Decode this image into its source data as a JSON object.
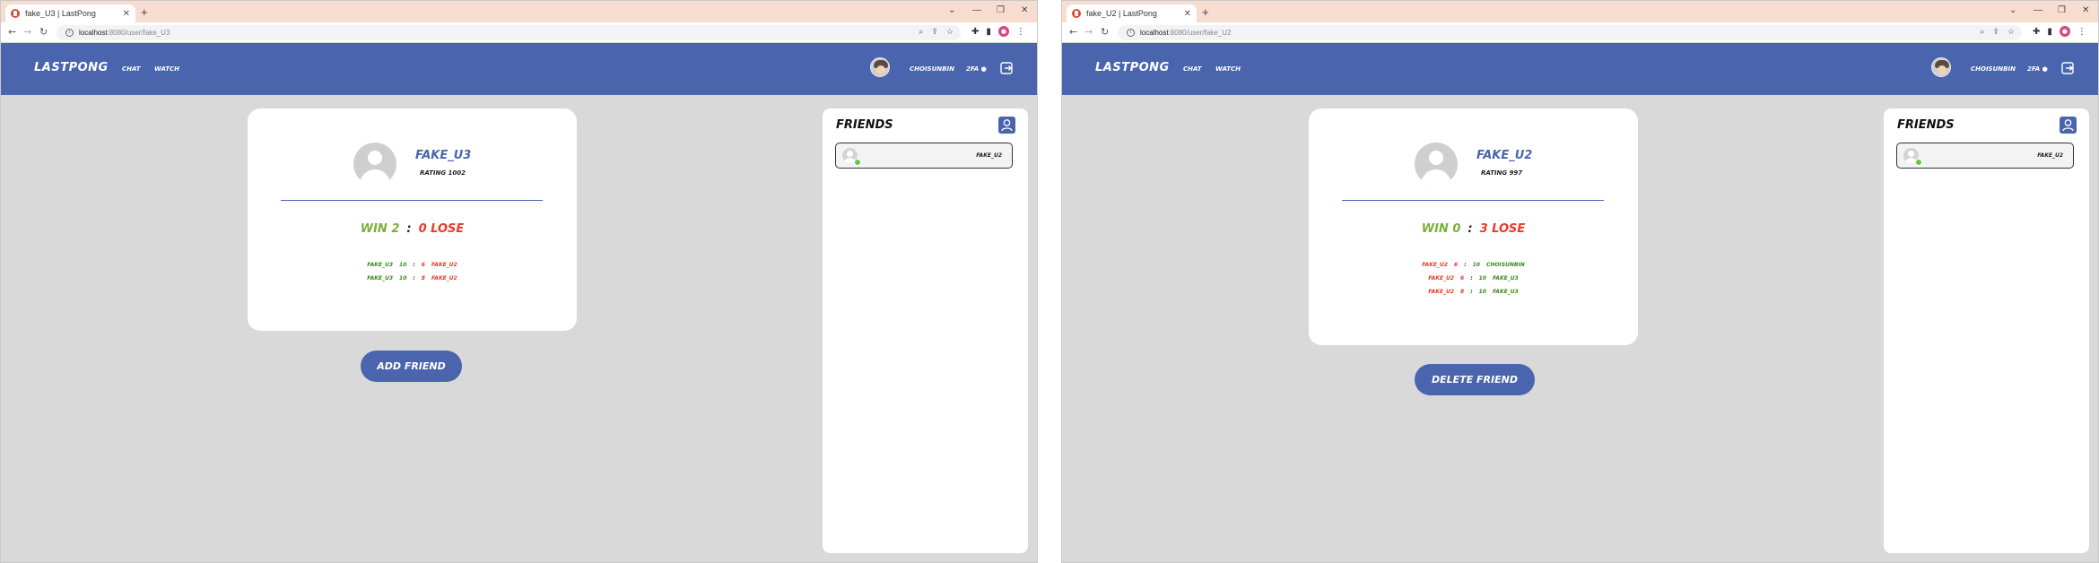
{
  "windows": [
    {
      "tab_title": "fake_U3 | LastPong",
      "url_host": "localhost",
      "url_path": ":8080/user/fake_U3",
      "app": {
        "logo": "LASTPONG",
        "nav_chat": "CHAT",
        "nav_watch": "WATCH",
        "username": "CHOISUNBIN",
        "twofa": "2FA"
      },
      "profile": {
        "name": "FAKE_U3",
        "rating": "RATING 1002",
        "win_label": "WIN 2",
        "colon": ":",
        "lose_label": "0 LOSE",
        "history": [
          {
            "p1": "FAKE_U3",
            "s1": "10",
            "sep": ":",
            "s2": "6",
            "p2": "FAKE_U2",
            "c1": "#3a8a1f",
            "c2": "#e83a2a"
          },
          {
            "p1": "FAKE_U3",
            "s1": "10",
            "sep": ":",
            "s2": "8",
            "p2": "FAKE_U2",
            "c1": "#3a8a1f",
            "c2": "#e83a2a"
          }
        ]
      },
      "action_button": "ADD FRIEND",
      "friends": {
        "title": "FRIENDS",
        "items": [
          {
            "name": "FAKE_U2",
            "status": "online"
          }
        ]
      }
    },
    {
      "tab_title": "fake_U2 | LastPong",
      "url_host": "localhost",
      "url_path": ":8080/user/fake_U2",
      "app": {
        "logo": "LASTPONG",
        "nav_chat": "CHAT",
        "nav_watch": "WATCH",
        "username": "CHOISUNBIN",
        "twofa": "2FA"
      },
      "profile": {
        "name": "FAKE_U2",
        "rating": "RATING 997",
        "win_label": "WIN 0",
        "colon": ":",
        "lose_label": "3 LOSE",
        "history": [
          {
            "p1": "FAKE_U2",
            "s1": "6",
            "sep": ":",
            "s2": "10",
            "p2": "CHOISUNBIN",
            "c1": "#e83a2a",
            "c2": "#3a8a1f"
          },
          {
            "p1": "FAKE_U2",
            "s1": "6",
            "sep": ":",
            "s2": "10",
            "p2": "FAKE_U3",
            "c1": "#e83a2a",
            "c2": "#3a8a1f"
          },
          {
            "p1": "FAKE_U2",
            "s1": "8",
            "sep": ":",
            "s2": "10",
            "p2": "FAKE_U3",
            "c1": "#e83a2a",
            "c2": "#3a8a1f"
          }
        ]
      },
      "action_button": "DELETE FRIEND",
      "friends": {
        "title": "FRIENDS",
        "items": [
          {
            "name": "FAKE_U2",
            "status": "online"
          }
        ]
      }
    }
  ],
  "colors": {
    "brand": "#4a65ae",
    "background": "#d9d9d9",
    "win": "#7ab03a",
    "lose": "#e83a2a",
    "online": "#6cc24a"
  }
}
